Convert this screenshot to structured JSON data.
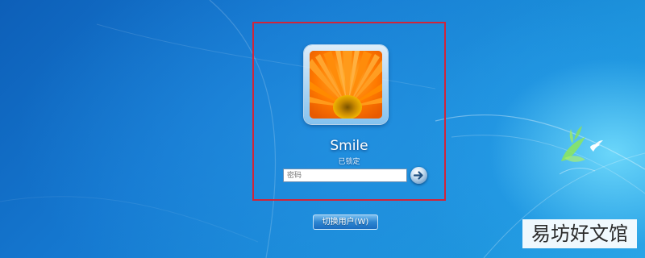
{
  "login": {
    "username": "Smile",
    "status": "已锁定",
    "password_placeholder": "密码",
    "password_value": "",
    "submit_icon": "arrow-right-icon",
    "switch_user_label": "切换用户(W)"
  },
  "watermark": {
    "text": "易坊好文馆"
  },
  "colors": {
    "focus_box": "#d0253a",
    "wallpaper_blue": "#1578d0",
    "flower_orange": "#ff7a00"
  }
}
